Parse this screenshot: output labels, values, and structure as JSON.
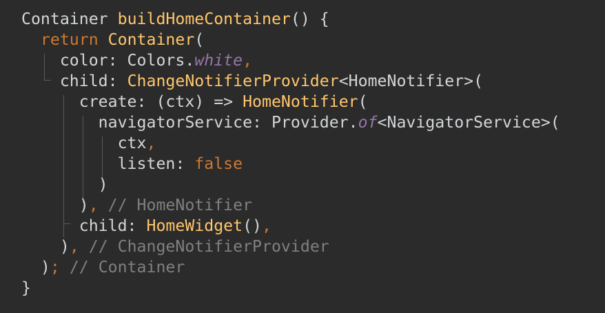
{
  "editor": {
    "background": "#2b2b2b",
    "colors": {
      "keyword": "#cc7832",
      "function": "#ffc66d",
      "plain": "#d3d6d9",
      "static_member": "#9876aa",
      "comment": "#808080"
    },
    "lines": [
      [
        {
          "t": "Container ",
          "c": "pl"
        },
        {
          "t": "buildHomeContainer",
          "c": "fn"
        },
        {
          "t": "() {",
          "c": "pl"
        }
      ],
      [
        {
          "t": "  ",
          "c": "pl"
        },
        {
          "t": "return ",
          "c": "kw"
        },
        {
          "t": "Container",
          "c": "fn"
        },
        {
          "t": "(",
          "c": "pl"
        }
      ],
      [
        {
          "t": "    color: Colors.",
          "c": "pl"
        },
        {
          "t": "white",
          "c": "it"
        },
        {
          "t": ",",
          "c": "kw"
        }
      ],
      [
        {
          "t": "    child: ",
          "c": "pl"
        },
        {
          "t": "ChangeNotifierProvider",
          "c": "fn"
        },
        {
          "t": "<HomeNotifier>(",
          "c": "pl"
        }
      ],
      [
        {
          "t": "      create: (ctx) => ",
          "c": "pl"
        },
        {
          "t": "HomeNotifier",
          "c": "fn"
        },
        {
          "t": "(",
          "c": "pl"
        }
      ],
      [
        {
          "t": "        navigatorService: Provider.",
          "c": "pl"
        },
        {
          "t": "of",
          "c": "it"
        },
        {
          "t": "<NavigatorService>(",
          "c": "pl"
        }
      ],
      [
        {
          "t": "          ctx",
          "c": "pl"
        },
        {
          "t": ",",
          "c": "kw"
        }
      ],
      [
        {
          "t": "          listen: ",
          "c": "pl"
        },
        {
          "t": "false",
          "c": "kw"
        }
      ],
      [
        {
          "t": "        )",
          "c": "pl"
        }
      ],
      [
        {
          "t": "      )",
          "c": "pl"
        },
        {
          "t": ", ",
          "c": "kw"
        },
        {
          "t": "// HomeNotifier",
          "c": "cm"
        }
      ],
      [
        {
          "t": "      child: ",
          "c": "pl"
        },
        {
          "t": "HomeWidget",
          "c": "fn"
        },
        {
          "t": "()",
          "c": "pl"
        },
        {
          "t": ",",
          "c": "kw"
        }
      ],
      [
        {
          "t": "    )",
          "c": "pl"
        },
        {
          "t": ", ",
          "c": "kw"
        },
        {
          "t": "// ChangeNotifierProvider",
          "c": "cm"
        }
      ],
      [
        {
          "t": "  )",
          "c": "pl"
        },
        {
          "t": "; ",
          "c": "kw"
        },
        {
          "t": "// Container",
          "c": "cm"
        }
      ],
      [
        {
          "t": "}",
          "c": "pl"
        }
      ]
    ]
  }
}
